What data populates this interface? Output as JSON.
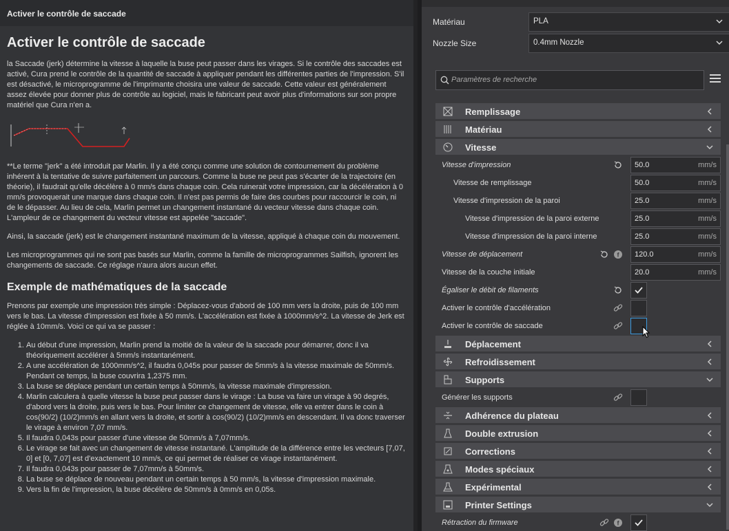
{
  "tooltip": {
    "window_title": "Activer le contrôle de saccade",
    "heading": "Activer le contrôle de saccade",
    "paragraphs": [
      "la Saccade (jerk) détermine la vitesse à laquelle la buse peut passer dans les virages. Si le contrôle des saccades est activé, Cura prend le contrôle de la quantité de saccade à appliquer pendant les différentes parties de l'impression. S'il est désactivé, le microprogramme de l'imprimante choisira une valeur de saccade. Cette valeur est généralement assez élevée pour donner plus de contrôle au logiciel, mais le fabricant peut avoir plus d'informations sur son propre matériel que Cura n'en a.",
      "**Le terme \"jerk\" a été introduit par Marlin. Il y a été conçu comme une solution de contournement du problème inhérent à la tentative de suivre parfaitement un parcours. Comme la buse ne peut pas s'écarter de la trajectoire (en théorie), il faudrait qu'elle décélère à 0 mm/s dans chaque coin. Cela ruinerait votre impression, car la décélération à 0 mm/s provoquerait une marque dans chaque coin. Il n'est pas permis de faire des courbes pour raccourcir le coin, ni de le dépasser. Au lieu de cela, Marlin permet un changement instantané du vecteur vitesse dans chaque coin. L'ampleur de ce changement du vecteur vitesse est appelée \"saccade\".",
      "Ainsi, la saccade (jerk) est le changement instantané maximum de la vitesse, appliqué à chaque coin du mouvement.",
      "Les microprogrammes qui ne sont pas basés sur Marlin, comme la famille de microprogrammes Sailfish, ignorent les changements de saccade. Ce réglage n'aura alors aucun effet."
    ],
    "subheading": "Exemple de mathématiques de la saccade",
    "example_intro": "Prenons par exemple une impression très simple : Déplacez-vous d'abord de 100 mm vers la droite, puis de 100 mm vers le bas. La vitesse d'impression est fixée à 50 mm/s. L'accélération est fixée à 1000mm/s^2. La vitesse de Jerk est réglée à 10mm/s. Voici ce qui va se passer :",
    "steps": [
      "Au début d'une impression, Marlin prend la moitié de la valeur de la saccade pour démarrer, donc il va théoriquement accélérer à 5mm/s instantanément.",
      "A une accélération de 1000mm/s^2, il faudra 0,045s pour passer de 5mm/s à la vitesse maximale de 50mm/s. Pendant ce temps, la buse couvrira 1,2375 mm.",
      "La buse se déplace pendant un certain temps à 50mm/s, la vitesse maximale d'impression.",
      "Marlin calculera à quelle vitesse la buse peut passer dans le virage : La buse va faire un virage à 90 degrés, d'abord vers la droite, puis vers le bas. Pour limiter ce changement de vitesse, elle va entrer dans le coin à cos(90/2) (10/2)mm/s en allant vers la droite, et sortir à cos(90/2) (10/2)mm/s en descendant. Il va donc traverser le virage à environ 7,07 mm/s.",
      "Il faudra 0,043s pour passer d'une vitesse de 50mm/s à 7,07mm/s.",
      "Le virage se fait avec un changement de vitesse instantané. L'amplitude de la différence entre les vecteurs [7,07, 0] et [0, 7,07] est d'exactement 10 mm/s, ce qui permet de réaliser ce virage instantanément.",
      "Il faudra 0,043s pour passer de 7,07mm/s à 50mm/s.",
      "La buse se déplace de nouveau pendant un certain temps à 50 mm/s, la vitesse d'impression maximale.",
      "Vers la fin de l'impression, la buse décélère de 50mm/s à 0mm/s en 0,05s."
    ]
  },
  "printer": {
    "material_label": "Matériau",
    "material_value": "PLA",
    "nozzle_label": "Nozzle Size",
    "nozzle_value": "0.4mm Nozzle"
  },
  "search": {
    "placeholder": "Paramètres de recherche"
  },
  "categories": {
    "infill": "Remplissage",
    "material": "Matériau",
    "speed": "Vitesse",
    "travel": "Déplacement",
    "cooling": "Refroidissement",
    "support": "Supports",
    "adhesion": "Adhérence du plateau",
    "dual": "Double extrusion",
    "fixes": "Corrections",
    "special": "Modes spéciaux",
    "experimental": "Expérimental",
    "printer_settings": "Printer Settings"
  },
  "speed_settings": [
    {
      "label": "Vitesse d'impression",
      "value": "50.0",
      "unit": "mm/s"
    },
    {
      "label": "Vitesse de remplissage",
      "value": "50.0",
      "unit": "mm/s"
    },
    {
      "label": "Vitesse d'impression de la paroi",
      "value": "25.0",
      "unit": "mm/s"
    },
    {
      "label": "Vitesse d'impression de la paroi externe",
      "value": "25.0",
      "unit": "mm/s"
    },
    {
      "label": "Vitesse d'impression de la paroi interne",
      "value": "25.0",
      "unit": "mm/s"
    },
    {
      "label": "Vitesse de déplacement",
      "value": "120.0",
      "unit": "mm/s"
    },
    {
      "label": "Vitesse de la couche initiale",
      "value": "20.0",
      "unit": "mm/s"
    },
    {
      "label": "Égaliser le débit de filaments"
    },
    {
      "label": "Activer le contrôle d'accélération"
    },
    {
      "label": "Activer le contrôle de saccade"
    }
  ],
  "support_settings": [
    {
      "label": "Générer les supports"
    }
  ],
  "printer_settings_rows": [
    {
      "label": "Rétraction du firmware"
    }
  ],
  "colors": {
    "accent": "#3c9be0",
    "panel": "#39393c",
    "category": "#4b4b4f",
    "tooltip_bg": "#333437"
  }
}
